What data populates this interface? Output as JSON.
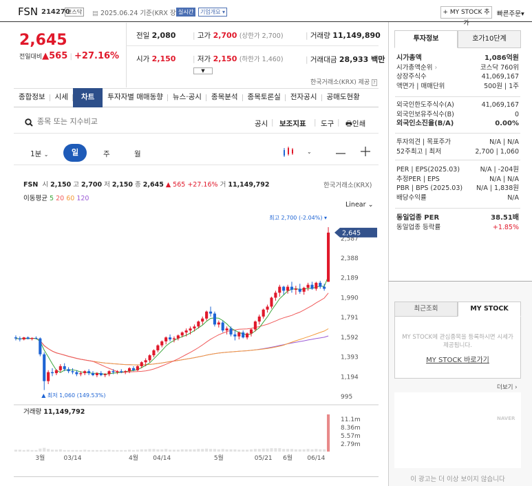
{
  "header": {
    "stock_name": "FSN",
    "stock_code": "214270",
    "market_badge": "코스닥",
    "base_date": "2025.06.24 기준(KRX 장마감)",
    "realtime_badge": "실시간",
    "overview_badge": "기업개요",
    "my_stock_button": "+ MY STOCK 추가",
    "quick_order": "빠른주문"
  },
  "price": {
    "current": "2,645",
    "change_label": "전일대비",
    "change_amount": "565",
    "change_percent": "+27.16%",
    "prev_close_label": "전일",
    "prev_close": "2,080",
    "high_label": "고가",
    "high": "2,700",
    "upper_limit": "(상한가 2,700)",
    "volume_label": "거래량",
    "volume": "11,149,890",
    "open_label": "시가",
    "open": "2,150",
    "low_label": "저가",
    "low": "2,150",
    "lower_limit": "(하한가 1,460)",
    "amount_label": "거래대금",
    "amount": "28,933 백만",
    "source_note": "한국거래소(KRX) 제공"
  },
  "nav_tabs": [
    "종합정보",
    "시세",
    "차트",
    "투자자별 매매동향",
    "뉴스·공시",
    "종목분석",
    "종목토론실",
    "전자공시",
    "공매도현황"
  ],
  "active_tab": "차트",
  "search": {
    "placeholder": "종목 또는 지수비교",
    "tools": [
      "공시",
      "보조지표",
      "도구",
      "인쇄"
    ]
  },
  "periods": {
    "minute": "1분",
    "day": "일",
    "week": "주",
    "month": "월"
  },
  "chart_header": {
    "name": "FSN",
    "open_label": "시",
    "open": "2,150",
    "high_label": "고",
    "high": "2,700",
    "low_label": "저",
    "low": "2,150",
    "close_label": "종",
    "close": "2,645",
    "change": "▲ 565",
    "change_pct": "+27.16%",
    "vol_label": "거",
    "volume": "11,149,792",
    "exchange": "한국거래소(KRX)",
    "ma_label": "이동평균",
    "ma": [
      {
        "period": "5",
        "color": "#3aa63a"
      },
      {
        "period": "20",
        "color": "#f05a5a"
      },
      {
        "period": "60",
        "color": "#f39a3b"
      },
      {
        "period": "120",
        "color": "#9b5bd6"
      }
    ],
    "scale": "Linear",
    "max_note": "최고 2,700 (-2.04%)",
    "min_note": "▲ 최저 1,060 (149.53%)",
    "volume_title": "거래량",
    "volume_value": "11,149,792"
  },
  "chart_data": {
    "type": "candlestick",
    "price_axis": {
      "ticks": [
        995,
        1194,
        1393,
        1592,
        1791,
        1990,
        2189,
        2388,
        2587
      ],
      "ylim": [
        995,
        2700
      ]
    },
    "current_price_label": "2,645",
    "volume_axis": {
      "ticks": [
        "11.1m",
        "8.36m",
        "5.57m",
        "2.79m"
      ],
      "ylim": [
        0,
        11149792
      ]
    },
    "x_ticks": [
      "3월",
      "03/14",
      "4월",
      "04/14",
      "5월",
      "05/21",
      "6월",
      "06/14"
    ],
    "up_color": "#e0192b",
    "down_color": "#1e64d4",
    "candles": [
      [
        1590,
        1610,
        1560,
        1580
      ],
      [
        1580,
        1600,
        1550,
        1570
      ],
      [
        1570,
        1595,
        1560,
        1590
      ],
      [
        1590,
        1600,
        1570,
        1575
      ],
      [
        1575,
        1590,
        1560,
        1585
      ],
      [
        1585,
        1600,
        1570,
        1580
      ],
      [
        1580,
        1590,
        1400,
        1420
      ],
      [
        1420,
        1440,
        1060,
        1150
      ],
      [
        1150,
        1260,
        1120,
        1240
      ],
      [
        1240,
        1280,
        1200,
        1230
      ],
      [
        1230,
        1270,
        1210,
        1260
      ],
      [
        1260,
        1320,
        1240,
        1300
      ],
      [
        1300,
        1330,
        1250,
        1270
      ],
      [
        1270,
        1290,
        1230,
        1250
      ],
      [
        1250,
        1280,
        1220,
        1240
      ],
      [
        1240,
        1260,
        1200,
        1220
      ],
      [
        1220,
        1250,
        1200,
        1230
      ],
      [
        1230,
        1260,
        1210,
        1250
      ],
      [
        1250,
        1270,
        1210,
        1230
      ],
      [
        1230,
        1250,
        1200,
        1210
      ],
      [
        1210,
        1240,
        1190,
        1230
      ],
      [
        1230,
        1250,
        1200,
        1210
      ],
      [
        1210,
        1230,
        1190,
        1220
      ],
      [
        1220,
        1260,
        1200,
        1250
      ],
      [
        1250,
        1270,
        1220,
        1240
      ],
      [
        1240,
        1260,
        1220,
        1250
      ],
      [
        1250,
        1270,
        1230,
        1240
      ],
      [
        1240,
        1260,
        1220,
        1250
      ],
      [
        1250,
        1290,
        1230,
        1280
      ],
      [
        1280,
        1300,
        1250,
        1260
      ],
      [
        1260,
        1310,
        1250,
        1300
      ],
      [
        1300,
        1350,
        1280,
        1340
      ],
      [
        1340,
        1380,
        1300,
        1360
      ],
      [
        1360,
        1420,
        1340,
        1410
      ],
      [
        1410,
        1470,
        1390,
        1460
      ],
      [
        1460,
        1520,
        1440,
        1510
      ],
      [
        1510,
        1560,
        1490,
        1550
      ],
      [
        1550,
        1600,
        1520,
        1590
      ],
      [
        1590,
        1620,
        1550,
        1570
      ],
      [
        1570,
        1600,
        1540,
        1580
      ],
      [
        1580,
        1620,
        1560,
        1610
      ],
      [
        1610,
        1650,
        1590,
        1640
      ],
      [
        1640,
        1680,
        1600,
        1660
      ],
      [
        1660,
        1700,
        1620,
        1680
      ],
      [
        1680,
        1720,
        1650,
        1700
      ],
      [
        1700,
        1760,
        1680,
        1750
      ],
      [
        1750,
        1800,
        1720,
        1780
      ],
      [
        1780,
        1860,
        1760,
        1850
      ],
      [
        1850,
        1900,
        1800,
        1830
      ],
      [
        1830,
        1850,
        1700,
        1720
      ],
      [
        1720,
        1760,
        1690,
        1740
      ],
      [
        1740,
        1760,
        1640,
        1660
      ],
      [
        1660,
        1700,
        1620,
        1680
      ],
      [
        1680,
        1700,
        1600,
        1620
      ],
      [
        1620,
        1660,
        1560,
        1600
      ],
      [
        1600,
        1650,
        1570,
        1640
      ],
      [
        1640,
        1660,
        1580,
        1590
      ],
      [
        1590,
        1640,
        1570,
        1630
      ],
      [
        1630,
        1680,
        1600,
        1670
      ],
      [
        1670,
        1760,
        1650,
        1750
      ],
      [
        1750,
        1820,
        1720,
        1800
      ],
      [
        1800,
        1880,
        1780,
        1870
      ],
      [
        1870,
        1920,
        1840,
        1900
      ],
      [
        1900,
        2000,
        1880,
        1990
      ],
      [
        1990,
        2060,
        1960,
        2040
      ],
      [
        2040,
        2120,
        2000,
        2100
      ],
      [
        2100,
        2110,
        2020,
        2060
      ],
      [
        2060,
        2120,
        2030,
        2100
      ],
      [
        2100,
        2150,
        2040,
        2070
      ],
      [
        2070,
        2110,
        2020,
        2080
      ],
      [
        2080,
        2130,
        2030,
        2050
      ],
      [
        2050,
        2100,
        2020,
        2090
      ],
      [
        2090,
        2140,
        2060,
        2120
      ],
      [
        2120,
        2150,
        2070,
        2080
      ],
      [
        2080,
        2150,
        2060,
        2140
      ],
      [
        2140,
        2160,
        2080,
        2100
      ],
      [
        2100,
        2130,
        2060,
        2080
      ],
      [
        2150,
        2700,
        2150,
        2645
      ]
    ],
    "volume_fraction": [
      0.05,
      0.05,
      0.04,
      0.05,
      0.04,
      0.04,
      0.08,
      0.1,
      0.07,
      0.05,
      0.05,
      0.06,
      0.04,
      0.04,
      0.04,
      0.04,
      0.04,
      0.05,
      0.04,
      0.04,
      0.04,
      0.04,
      0.04,
      0.05,
      0.04,
      0.04,
      0.04,
      0.04,
      0.05,
      0.04,
      0.05,
      0.06,
      0.06,
      0.07,
      0.07,
      0.06,
      0.06,
      0.07,
      0.05,
      0.05,
      0.05,
      0.06,
      0.06,
      0.06,
      0.06,
      0.07,
      0.07,
      0.08,
      0.07,
      0.07,
      0.06,
      0.07,
      0.06,
      0.06,
      0.06,
      0.05,
      0.05,
      0.05,
      0.06,
      0.07,
      0.07,
      0.08,
      0.08,
      0.09,
      0.09,
      0.09,
      0.07,
      0.07,
      0.07,
      0.06,
      0.06,
      0.06,
      0.07,
      0.06,
      0.07,
      0.06,
      0.06,
      1.0
    ]
  },
  "side_tabs": [
    "투자정보",
    "호가10단계"
  ],
  "invest_info": {
    "market_cap_label": "시가총액",
    "market_cap": "1,086억원",
    "market_cap_rank_label": "시가총액순위",
    "market_cap_rank": "코스닥 760위",
    "shares_label": "상장주식수",
    "shares": "41,069,167",
    "face_label": "액면가 | 매매단위",
    "face": "500원 | 1주",
    "foreign_limit_label": "외국인한도주식수(A)",
    "foreign_limit": "41,069,167",
    "foreign_hold_label": "외국인보유주식수(B)",
    "foreign_hold": "0",
    "foreign_ratio_label": "외국인소진율(B/A)",
    "foreign_ratio": "0.00%",
    "opinion_label": "투자의견 | 목표주가",
    "opinion": "N/A | N/A",
    "range52_label": "52주최고 | 최저",
    "range52": "2,700 | 1,060",
    "per_label": "PER | EPS(2025.03)",
    "per": "N/A | -204원",
    "est_per_label": "추정PER | EPS",
    "est_per": "N/A | N/A",
    "pbr_label": "PBR | BPS (2025.03)",
    "pbr": "N/A | 1,838원",
    "dividend_label": "배당수익률",
    "dividend": "N/A",
    "industry_per_label": "동일업종 PER",
    "industry_per": "38.51배",
    "industry_change_label": "동일업종 등락률",
    "industry_change": "+1.85%"
  },
  "lower_panel": {
    "tabs": [
      "최근조회",
      "MY STOCK"
    ],
    "message": "MY STOCK에 관심종목을 등록하시면 시세가 제공됩니다.",
    "link": "MY STOCK 바로가기",
    "more": "더보기",
    "ad_brand": "NAVER",
    "ad_note": "이 광고는 더 이상 보이지 않습니다"
  }
}
